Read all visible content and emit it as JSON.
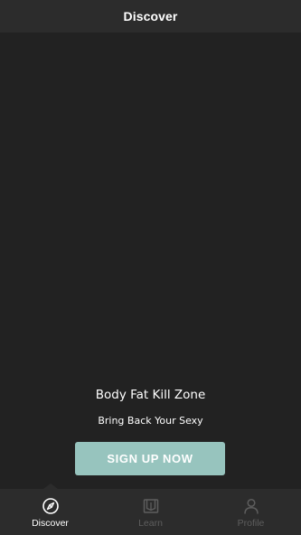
{
  "header": {
    "title": "Discover"
  },
  "promo": {
    "title": "Body Fat Kill Zone",
    "subtitle": "Bring Back Your Sexy",
    "signup_label": "SIGN UP NOW"
  },
  "tabbar": {
    "active_tab": "Discover",
    "tabs": [
      {
        "label": "Discover",
        "icon": "compass-icon"
      },
      {
        "label": "Learn",
        "icon": "book-icon"
      },
      {
        "label": "Profile",
        "icon": "person-icon"
      }
    ]
  },
  "colors": {
    "background": "#222222",
    "bar": "#2c2c2c",
    "accent_button": "#97c4be",
    "inactive_tab": "#5e5e5e",
    "active_tab": "#ffffff"
  }
}
